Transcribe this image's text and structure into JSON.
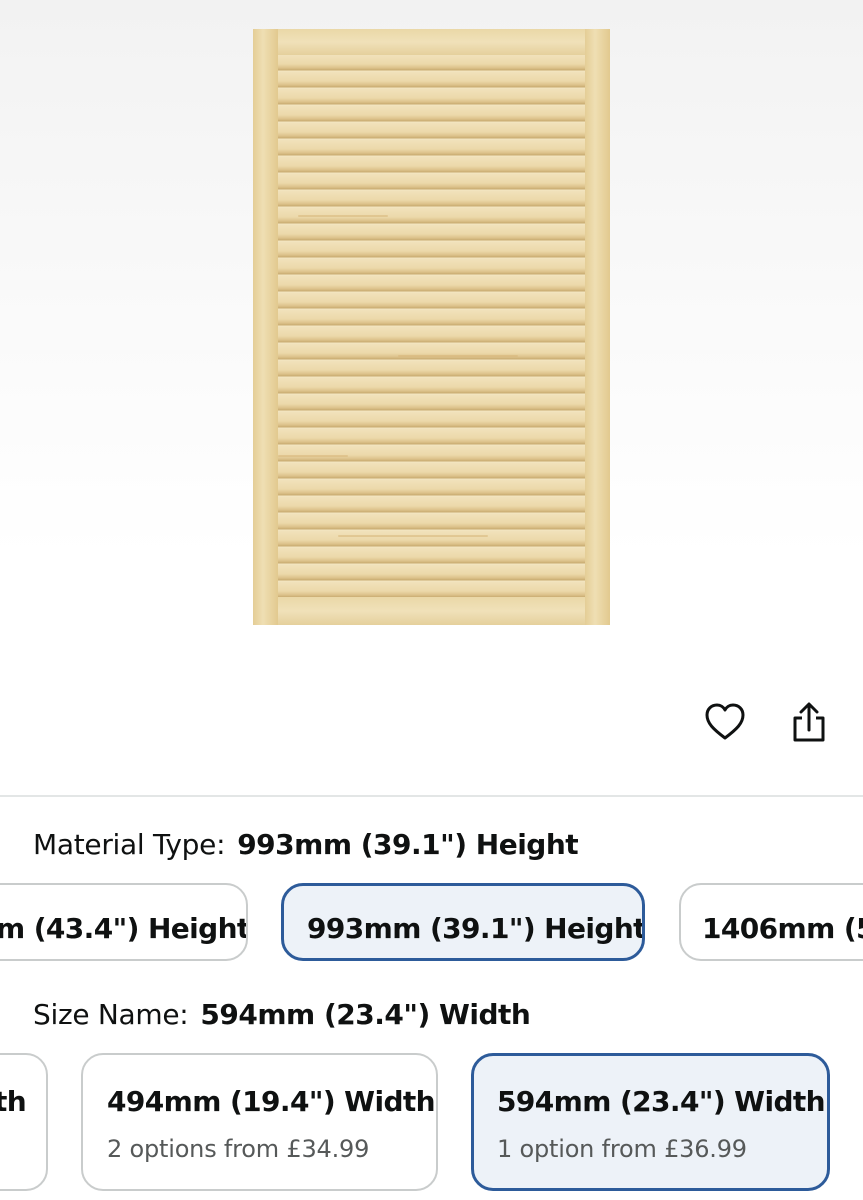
{
  "product": {
    "image_alt": "Louvred pine shutter door",
    "actions": {
      "favorite_icon": "heart-icon",
      "share_icon": "share-icon"
    }
  },
  "material": {
    "label": "Material Type:",
    "selected": "993mm (39.1\") Height",
    "options": [
      {
        "label": "m (43.4\") Height"
      },
      {
        "label": "993mm (39.1\") Height",
        "selected": true
      },
      {
        "label": "1406mm (5"
      }
    ]
  },
  "size": {
    "label": "Size Name:",
    "selected": "594mm (23.4\") Width",
    "options": [
      {
        "label": "th",
        "sub": ""
      },
      {
        "label": "494mm (19.4\") Width",
        "sub": "2 options from £34.99"
      },
      {
        "label": "594mm (23.4\") Width",
        "sub": "1 option from £36.99",
        "selected": true
      }
    ]
  },
  "colors": {
    "selected_border": "#2d5b9a",
    "selected_bg": "#edf2f8",
    "wood": "#e9d7a8"
  }
}
